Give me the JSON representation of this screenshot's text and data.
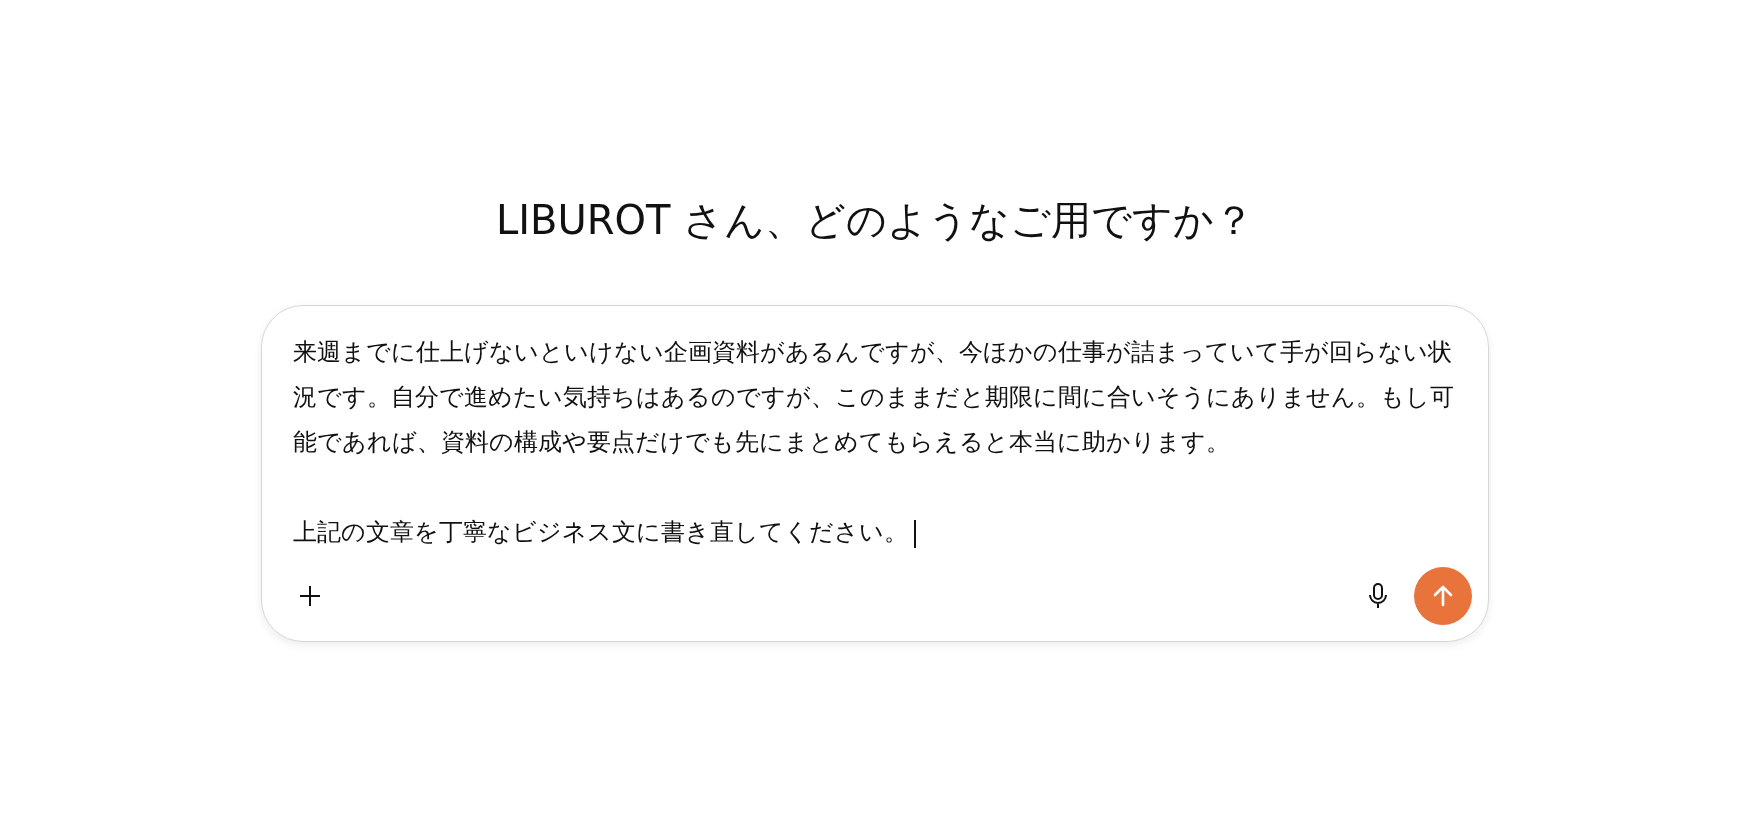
{
  "greeting": "LIBUROT さん、どのようなご用ですか？",
  "composer": {
    "paragraphs": [
      "来週までに仕上げないといけない企画資料があるんですが、今ほかの仕事が詰まっていて手が回らない状況です。自分で進めたい気持ちはあるのですが、このままだと期限に間に合いそうにありません。もし可能であれば、資料の構成や要点だけでも先にまとめてもらえると本当に助かります。",
      "上記の文章を丁寧なビジネス文に書き直してください。"
    ]
  }
}
